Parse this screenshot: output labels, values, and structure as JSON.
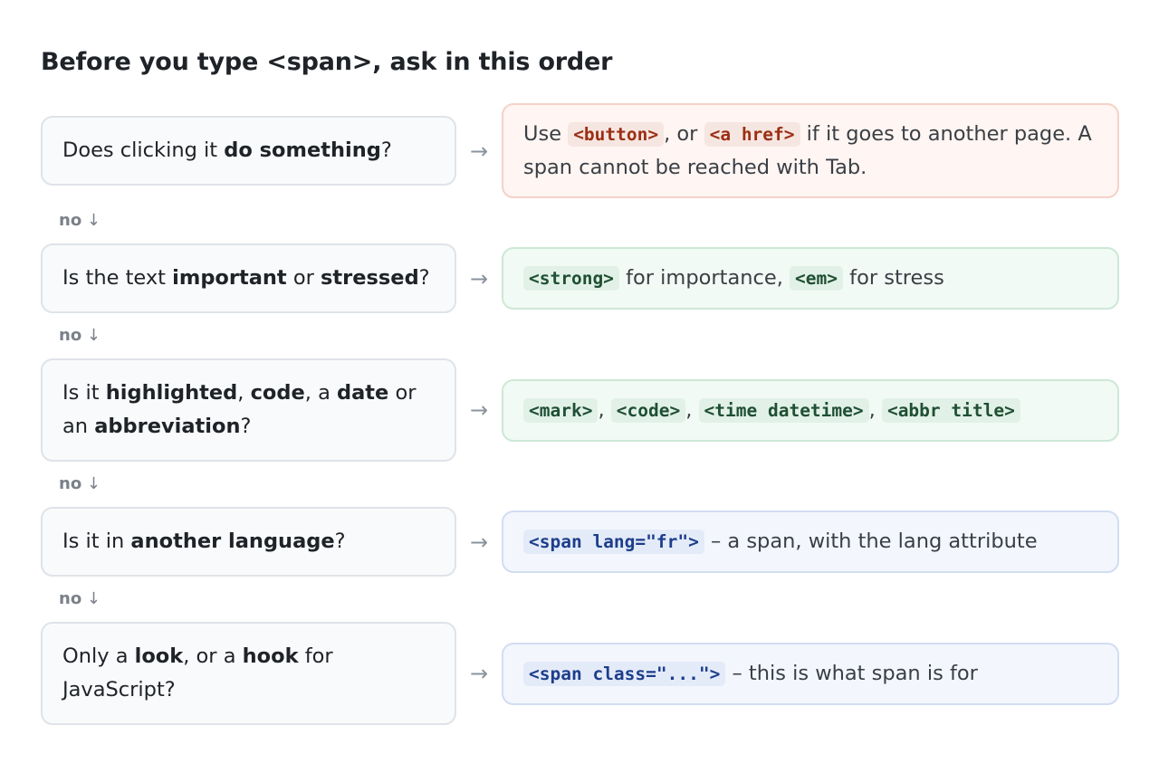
{
  "title": "Before you type <span>, ask in this order",
  "arrow": "→",
  "no_label": "no",
  "down_arrow": "↓",
  "steps": [
    {
      "question": [
        "Does clicking it ",
        {
          "b": "do something"
        },
        "?"
      ],
      "answer": [
        {
          "t": "Use "
        },
        {
          "c": "<button>"
        },
        {
          "t": ", or "
        },
        {
          "c": "<a href>"
        },
        {
          "t": " if it goes to another page. A span cannot be reached with Tab."
        }
      ],
      "tone": "red"
    },
    {
      "question": [
        "Is the text ",
        {
          "b": "important"
        },
        " or ",
        {
          "b": "stressed"
        },
        "?"
      ],
      "answer": [
        {
          "c": "<strong>"
        },
        {
          "t": " for importance, "
        },
        {
          "c": "<em>"
        },
        {
          "t": " for stress"
        }
      ],
      "tone": "green"
    },
    {
      "question": [
        "Is it ",
        {
          "b": "highlighted"
        },
        ", ",
        {
          "b": "code"
        },
        ", a ",
        {
          "b": "date"
        },
        " or an ",
        {
          "b": "abbreviation"
        },
        "?"
      ],
      "answer": [
        {
          "c": "<mark>"
        },
        {
          "t": ", "
        },
        {
          "c": "<code>"
        },
        {
          "t": ", "
        },
        {
          "c": "<time datetime>"
        },
        {
          "t": ", "
        },
        {
          "c": "<abbr title>"
        }
      ],
      "tone": "green"
    },
    {
      "question": [
        "Is it in ",
        {
          "b": "another language"
        },
        "?"
      ],
      "answer": [
        {
          "c": "<span lang=\"fr\">"
        },
        {
          "t": " – a span, with the lang attribute"
        }
      ],
      "tone": "blue"
    },
    {
      "question": [
        "Only a ",
        {
          "b": "look"
        },
        ", or a ",
        {
          "b": "hook"
        },
        " for JavaScript?"
      ],
      "answer": [
        {
          "c": "<span class=\"...\">"
        },
        {
          "t": " – this is what span is for"
        }
      ],
      "tone": "blue"
    }
  ],
  "colors": {
    "red_bg": "#fff5f2",
    "red_code": "#9b2f14",
    "green_bg": "#f1faf4",
    "green_code": "#1f4f33",
    "blue_bg": "#f3f6fd",
    "blue_code": "#1d3e8c"
  }
}
